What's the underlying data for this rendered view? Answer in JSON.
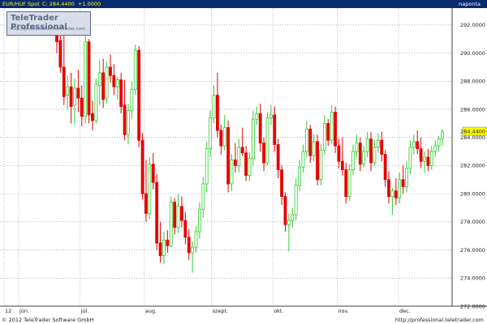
{
  "header": {
    "symbol": "EUR/HUF Spot",
    "close_label": "C: 284.4400",
    "change": "+1.0000",
    "period": "naponta"
  },
  "logo": {
    "title": "TeleTrader Professional",
    "url": "http://professional.teletrader.com"
  },
  "footer": {
    "copyright": "© 2012 TeleTrader Software GmbH",
    "url": "http://professional.teletrader.com"
  },
  "colors": {
    "background": "#ffffff",
    "header_bg": "#0a2a6e",
    "up_candle": "#33cc33",
    "down_candle": "#e60000",
    "grid": "#8888aa",
    "last_price_tag": "#ffff00"
  },
  "chart_data": {
    "type": "candlestick",
    "title": "",
    "xlabel": "",
    "ylabel": "",
    "ylim": [
      272.0,
      293.2
    ],
    "y_ticks": [
      "272.0000",
      "274.0000",
      "276.0000",
      "278.0000",
      "280.0000",
      "282.0000",
      "284.0000",
      "286.0000",
      "288.0000",
      "290.0000",
      "292.0000"
    ],
    "x_ticks": [
      {
        "label": "12",
        "day": 0
      },
      {
        "label": "jún.",
        "day": 5
      },
      {
        "label": "júl.",
        "day": 26
      },
      {
        "label": "aug.",
        "day": 48
      },
      {
        "label": "szept.",
        "day": 71
      },
      {
        "label": "okt.",
        "day": 92
      },
      {
        "label": "nov.",
        "day": 114
      },
      {
        "label": "dec.",
        "day": 135
      }
    ],
    "last_price": "284.4400",
    "grid": true,
    "candles": [
      {
        "o": 291.5,
        "h": 292.4,
        "l": 290.0,
        "c": 290.8
      },
      {
        "o": 290.9,
        "h": 292.7,
        "l": 288.6,
        "c": 289.0
      },
      {
        "o": 289.0,
        "h": 292.0,
        "l": 286.3,
        "c": 286.9
      },
      {
        "o": 287.0,
        "h": 288.4,
        "l": 286.0,
        "c": 287.6
      },
      {
        "o": 287.6,
        "h": 288.6,
        "l": 285.0,
        "c": 286.2
      },
      {
        "o": 286.3,
        "h": 288.2,
        "l": 284.9,
        "c": 287.5
      },
      {
        "o": 287.5,
        "h": 288.8,
        "l": 285.8,
        "c": 286.8
      },
      {
        "o": 286.8,
        "h": 287.7,
        "l": 284.8,
        "c": 285.5
      },
      {
        "o": 285.5,
        "h": 291.3,
        "l": 285.0,
        "c": 290.8
      },
      {
        "o": 290.8,
        "h": 291.0,
        "l": 285.0,
        "c": 285.6
      },
      {
        "o": 285.7,
        "h": 286.6,
        "l": 284.5,
        "c": 285.2
      },
      {
        "o": 285.2,
        "h": 288.2,
        "l": 285.0,
        "c": 287.8
      },
      {
        "o": 287.7,
        "h": 289.5,
        "l": 286.3,
        "c": 288.6
      },
      {
        "o": 288.6,
        "h": 289.6,
        "l": 286.1,
        "c": 286.7
      },
      {
        "o": 286.8,
        "h": 289.4,
        "l": 286.4,
        "c": 289.0
      },
      {
        "o": 289.0,
        "h": 289.9,
        "l": 287.9,
        "c": 288.4
      },
      {
        "o": 288.4,
        "h": 289.2,
        "l": 287.0,
        "c": 287.6
      },
      {
        "o": 287.6,
        "h": 288.3,
        "l": 286.7,
        "c": 288.1
      },
      {
        "o": 288.1,
        "h": 288.6,
        "l": 285.7,
        "c": 286.2
      },
      {
        "o": 286.3,
        "h": 288.1,
        "l": 283.8,
        "c": 284.2
      },
      {
        "o": 284.2,
        "h": 286.4,
        "l": 283.5,
        "c": 285.9
      },
      {
        "o": 285.9,
        "h": 288.0,
        "l": 285.3,
        "c": 287.4
      },
      {
        "o": 287.4,
        "h": 290.6,
        "l": 287.0,
        "c": 290.2
      },
      {
        "o": 290.2,
        "h": 290.5,
        "l": 283.3,
        "c": 283.8
      },
      {
        "o": 283.8,
        "h": 284.3,
        "l": 279.6,
        "c": 280.0
      },
      {
        "o": 280.0,
        "h": 282.4,
        "l": 278.0,
        "c": 278.6
      },
      {
        "o": 278.6,
        "h": 282.6,
        "l": 278.2,
        "c": 282.1
      },
      {
        "o": 282.1,
        "h": 282.9,
        "l": 280.3,
        "c": 280.8
      },
      {
        "o": 280.8,
        "h": 281.4,
        "l": 276.0,
        "c": 276.5
      },
      {
        "o": 276.5,
        "h": 278.0,
        "l": 275.1,
        "c": 275.6
      },
      {
        "o": 275.6,
        "h": 277.3,
        "l": 275.0,
        "c": 276.7
      },
      {
        "o": 276.7,
        "h": 277.4,
        "l": 275.8,
        "c": 276.3
      },
      {
        "o": 276.3,
        "h": 279.8,
        "l": 276.2,
        "c": 279.4
      },
      {
        "o": 279.4,
        "h": 279.7,
        "l": 277.1,
        "c": 277.6
      },
      {
        "o": 277.6,
        "h": 280.0,
        "l": 277.2,
        "c": 279.1
      },
      {
        "o": 279.1,
        "h": 279.8,
        "l": 277.6,
        "c": 278.1
      },
      {
        "o": 278.1,
        "h": 278.7,
        "l": 276.4,
        "c": 276.9
      },
      {
        "o": 276.9,
        "h": 277.5,
        "l": 275.3,
        "c": 275.8
      },
      {
        "o": 275.8,
        "h": 276.6,
        "l": 274.4,
        "c": 276.2
      },
      {
        "o": 276.2,
        "h": 277.7,
        "l": 275.8,
        "c": 277.3
      },
      {
        "o": 277.3,
        "h": 279.4,
        "l": 276.8,
        "c": 278.9
      },
      {
        "o": 278.9,
        "h": 281.2,
        "l": 278.3,
        "c": 280.7
      },
      {
        "o": 280.7,
        "h": 283.7,
        "l": 280.1,
        "c": 283.2
      },
      {
        "o": 283.2,
        "h": 285.9,
        "l": 282.6,
        "c": 285.4
      },
      {
        "o": 285.4,
        "h": 287.7,
        "l": 285.0,
        "c": 287.0
      },
      {
        "o": 287.0,
        "h": 288.6,
        "l": 284.0,
        "c": 284.5
      },
      {
        "o": 284.5,
        "h": 284.9,
        "l": 282.8,
        "c": 283.4
      },
      {
        "o": 283.4,
        "h": 285.6,
        "l": 283.1,
        "c": 284.7
      },
      {
        "o": 284.7,
        "h": 285.2,
        "l": 280.1,
        "c": 280.7
      },
      {
        "o": 280.7,
        "h": 282.8,
        "l": 280.2,
        "c": 282.4
      },
      {
        "o": 282.4,
        "h": 283.6,
        "l": 281.5,
        "c": 282.0
      },
      {
        "o": 282.0,
        "h": 283.9,
        "l": 281.5,
        "c": 283.3
      },
      {
        "o": 283.3,
        "h": 284.7,
        "l": 282.7,
        "c": 282.9
      },
      {
        "o": 282.9,
        "h": 283.4,
        "l": 280.9,
        "c": 281.3
      },
      {
        "o": 281.3,
        "h": 282.9,
        "l": 280.9,
        "c": 282.5
      },
      {
        "o": 282.5,
        "h": 285.9,
        "l": 282.0,
        "c": 285.3
      },
      {
        "o": 285.3,
        "h": 286.2,
        "l": 284.9,
        "c": 285.7
      },
      {
        "o": 285.7,
        "h": 286.4,
        "l": 283.0,
        "c": 283.6
      },
      {
        "o": 283.6,
        "h": 284.0,
        "l": 281.6,
        "c": 282.2
      },
      {
        "o": 282.2,
        "h": 285.8,
        "l": 282.0,
        "c": 285.4
      },
      {
        "o": 285.4,
        "h": 286.3,
        "l": 284.9,
        "c": 285.6
      },
      {
        "o": 285.6,
        "h": 286.2,
        "l": 283.0,
        "c": 283.5
      },
      {
        "o": 283.5,
        "h": 283.9,
        "l": 281.1,
        "c": 281.7
      },
      {
        "o": 281.7,
        "h": 282.0,
        "l": 279.2,
        "c": 279.8
      },
      {
        "o": 279.8,
        "h": 280.1,
        "l": 277.3,
        "c": 277.8
      },
      {
        "o": 277.8,
        "h": 278.6,
        "l": 275.9,
        "c": 278.1
      },
      {
        "o": 278.1,
        "h": 279.0,
        "l": 277.6,
        "c": 278.5
      },
      {
        "o": 278.5,
        "h": 281.1,
        "l": 278.1,
        "c": 280.6
      },
      {
        "o": 280.6,
        "h": 282.4,
        "l": 280.2,
        "c": 281.9
      },
      {
        "o": 281.9,
        "h": 283.5,
        "l": 281.5,
        "c": 283.0
      },
      {
        "o": 283.0,
        "h": 285.2,
        "l": 282.6,
        "c": 284.6
      },
      {
        "o": 284.6,
        "h": 284.9,
        "l": 282.2,
        "c": 282.7
      },
      {
        "o": 282.7,
        "h": 284.2,
        "l": 282.3,
        "c": 283.7
      },
      {
        "o": 283.7,
        "h": 284.2,
        "l": 280.6,
        "c": 281.0
      },
      {
        "o": 281.0,
        "h": 283.5,
        "l": 280.6,
        "c": 283.1
      },
      {
        "o": 283.1,
        "h": 285.6,
        "l": 282.8,
        "c": 285.0
      },
      {
        "o": 285.0,
        "h": 285.3,
        "l": 283.4,
        "c": 283.8
      },
      {
        "o": 283.8,
        "h": 286.3,
        "l": 283.5,
        "c": 285.8
      },
      {
        "o": 285.8,
        "h": 286.2,
        "l": 282.9,
        "c": 283.4
      },
      {
        "o": 283.4,
        "h": 283.9,
        "l": 281.8,
        "c": 282.3
      },
      {
        "o": 282.3,
        "h": 284.0,
        "l": 281.3,
        "c": 281.7
      },
      {
        "o": 281.7,
        "h": 282.2,
        "l": 279.3,
        "c": 279.8
      },
      {
        "o": 279.8,
        "h": 282.1,
        "l": 279.5,
        "c": 281.7
      },
      {
        "o": 281.7,
        "h": 283.5,
        "l": 281.3,
        "c": 283.0
      },
      {
        "o": 283.0,
        "h": 284.2,
        "l": 282.6,
        "c": 283.6
      },
      {
        "o": 283.6,
        "h": 284.0,
        "l": 281.6,
        "c": 282.1
      },
      {
        "o": 282.1,
        "h": 283.4,
        "l": 281.9,
        "c": 283.0
      },
      {
        "o": 283.0,
        "h": 284.4,
        "l": 282.6,
        "c": 283.9
      },
      {
        "o": 283.9,
        "h": 284.4,
        "l": 281.6,
        "c": 282.2
      },
      {
        "o": 282.2,
        "h": 283.8,
        "l": 282.0,
        "c": 283.3
      },
      {
        "o": 283.3,
        "h": 284.3,
        "l": 282.9,
        "c": 283.8
      },
      {
        "o": 283.8,
        "h": 284.4,
        "l": 282.3,
        "c": 282.8
      },
      {
        "o": 282.8,
        "h": 283.1,
        "l": 280.5,
        "c": 281.0
      },
      {
        "o": 281.0,
        "h": 281.6,
        "l": 279.3,
        "c": 279.8
      },
      {
        "o": 279.8,
        "h": 280.4,
        "l": 278.5,
        "c": 280.2
      },
      {
        "o": 280.2,
        "h": 281.1,
        "l": 279.2,
        "c": 279.7
      },
      {
        "o": 279.7,
        "h": 281.5,
        "l": 279.3,
        "c": 281.0
      },
      {
        "o": 281.0,
        "h": 282.0,
        "l": 280.0,
        "c": 280.5
      },
      {
        "o": 280.5,
        "h": 282.3,
        "l": 280.1,
        "c": 281.8
      },
      {
        "o": 281.8,
        "h": 283.8,
        "l": 281.4,
        "c": 283.3
      },
      {
        "o": 283.3,
        "h": 284.2,
        "l": 282.8,
        "c": 283.7
      },
      {
        "o": 283.7,
        "h": 284.5,
        "l": 282.8,
        "c": 283.2
      },
      {
        "o": 283.2,
        "h": 284.0,
        "l": 281.8,
        "c": 282.3
      },
      {
        "o": 282.3,
        "h": 283.0,
        "l": 281.5,
        "c": 282.6
      },
      {
        "o": 282.6,
        "h": 283.2,
        "l": 281.6,
        "c": 282.0
      },
      {
        "o": 282.0,
        "h": 283.4,
        "l": 281.7,
        "c": 283.0
      },
      {
        "o": 283.0,
        "h": 283.8,
        "l": 282.6,
        "c": 283.4
      },
      {
        "o": 283.4,
        "h": 284.1,
        "l": 283.0,
        "c": 283.9
      },
      {
        "o": 283.9,
        "h": 284.6,
        "l": 283.4,
        "c": 284.4
      }
    ]
  }
}
